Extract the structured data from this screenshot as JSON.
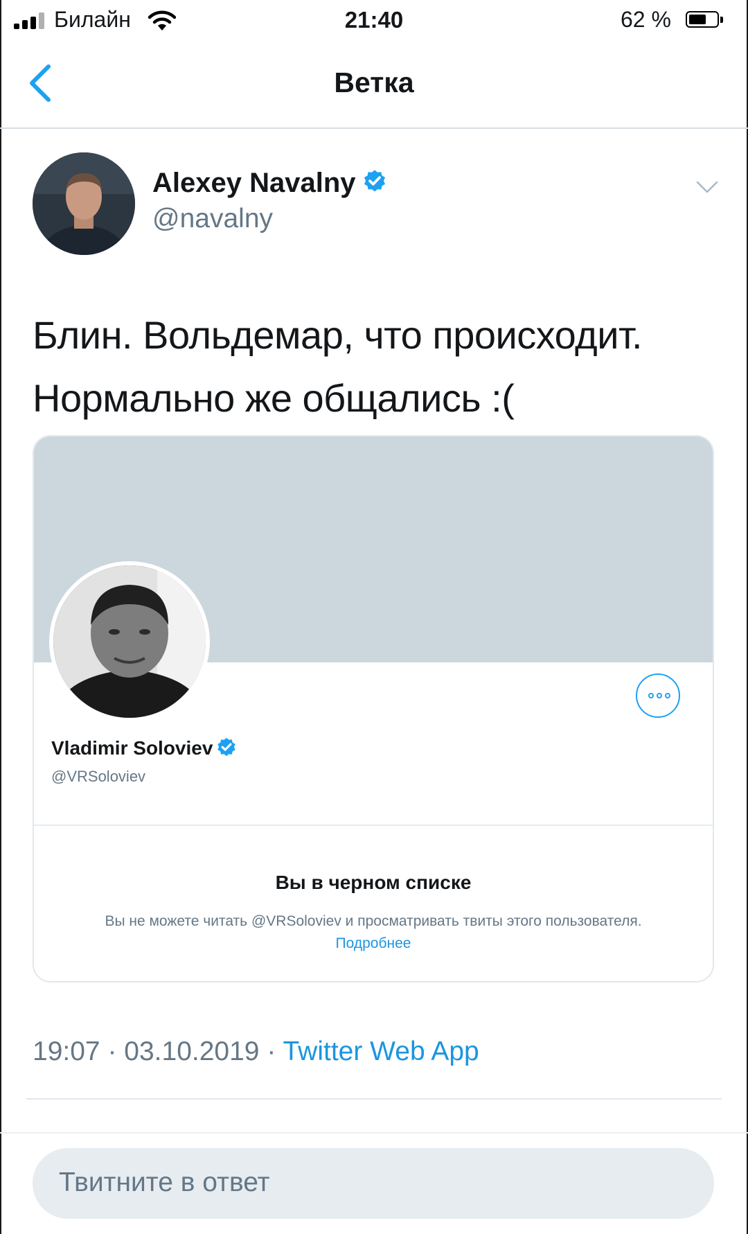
{
  "status_bar": {
    "carrier": "Билайн",
    "time": "21:40",
    "battery_percent": "62 %",
    "battery_level": 0.62
  },
  "nav": {
    "title": "Ветка"
  },
  "tweet": {
    "author_name": "Alexey Navalny",
    "author_handle": "@navalny",
    "text_line1": "Блин. Вольдемар, что происходит.",
    "text_line2": "Нормально же общались :(",
    "time": "19:07",
    "date": "03.10.2019",
    "separator": "·",
    "source": "Twitter Web App"
  },
  "card": {
    "profile_name": "Vladimir Soloviev",
    "profile_handle": "@VRSoloviev",
    "blocked_title": "Вы в черном списке",
    "blocked_text": "Вы не можете читать @VRSoloviev и просматривать твиты этого пользователя.",
    "learn_more": "Подробнее"
  },
  "reply": {
    "placeholder": "Твитните в ответ"
  },
  "colors": {
    "accent": "#1da1f2",
    "link": "#1b95e0",
    "secondary_text": "#657786",
    "banner": "#ccd6dd"
  },
  "icons": {
    "back": "chevron-left-icon",
    "verified": "verified-badge-icon",
    "caret": "chevron-down-icon",
    "more": "more-options-icon",
    "wifi": "wifi-icon",
    "battery": "battery-icon",
    "signal": "signal-icon"
  }
}
